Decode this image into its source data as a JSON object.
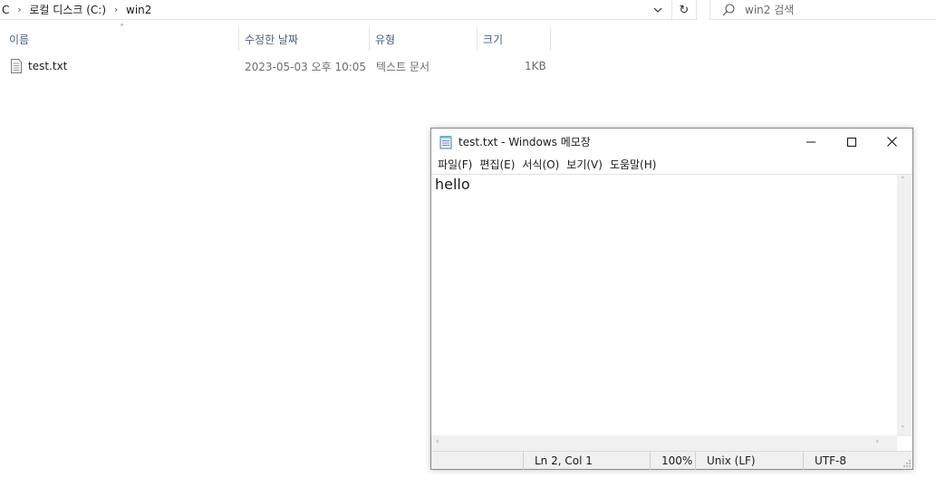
{
  "explorer": {
    "breadcrumb": [
      {
        "label": "C"
      },
      {
        "label": "로컬 디스크 (C:)"
      },
      {
        "label": "win2"
      }
    ],
    "search_placeholder": "win2 검색",
    "columns": {
      "name": "이름",
      "modified": "수정한 날짜",
      "type": "유형",
      "size": "크기"
    },
    "files": [
      {
        "name": "test.txt",
        "modified": "2023-05-03 오후 10:05",
        "type": "텍스트 문서",
        "size": "1KB"
      }
    ]
  },
  "notepad": {
    "title": "test.txt - Windows 메모장",
    "menu": [
      "파일(F)",
      "편집(E)",
      "서식(O)",
      "보기(V)",
      "도움말(H)"
    ],
    "content": "hello",
    "status": {
      "position": "Ln 2, Col 1",
      "zoom": "100%",
      "line_ending": "Unix (LF)",
      "encoding": "UTF-8"
    }
  }
}
